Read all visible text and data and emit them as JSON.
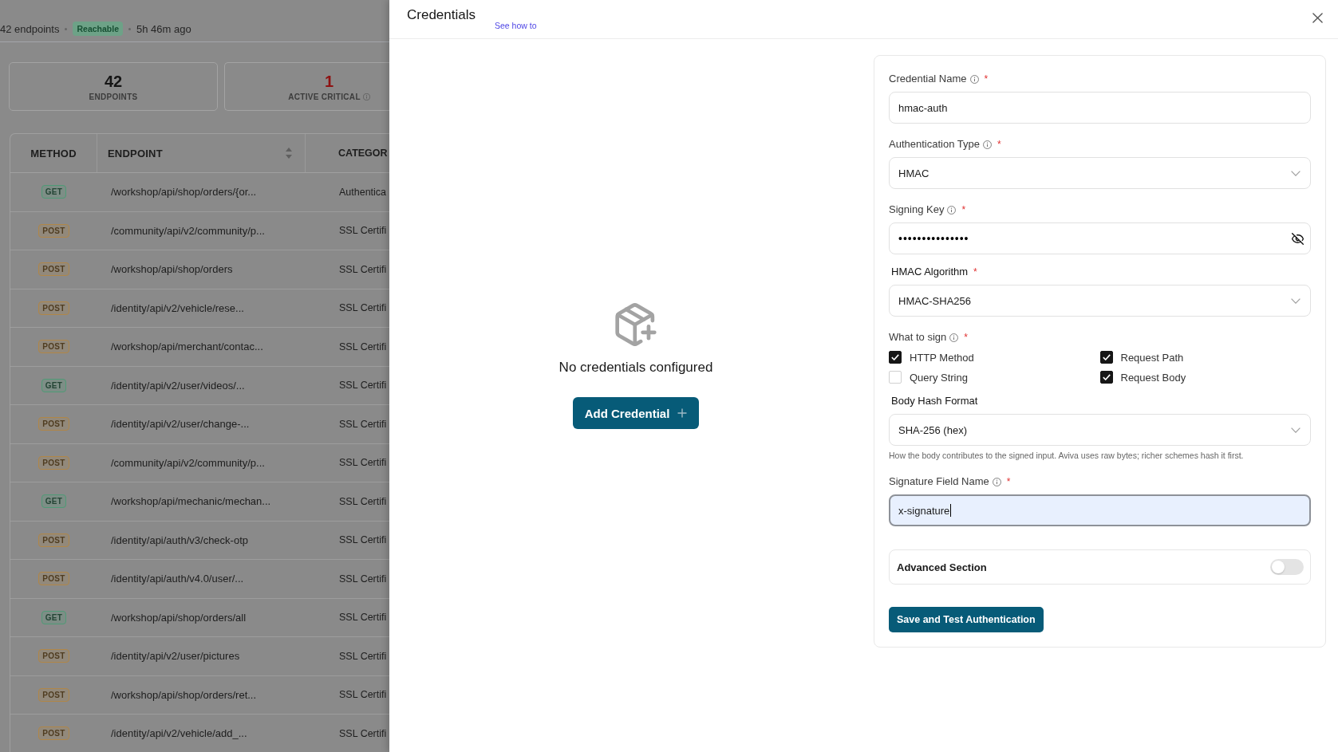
{
  "background_page": {
    "summary": {
      "endpoint_count": "42 endpoints",
      "status": "Reachable",
      "last_checked": "5h 46m ago"
    },
    "stats": [
      {
        "value": "42",
        "label": "ENDPOINTS",
        "kind": "count",
        "info": false
      },
      {
        "value": "1",
        "label": "ACTIVE CRITICAL",
        "kind": "critical",
        "info": true
      }
    ],
    "table": {
      "columns": [
        {
          "label": "METHOD",
          "sortable": false
        },
        {
          "label": "ENDPOINT",
          "sortable": true
        },
        {
          "label": "CATEGOR",
          "sortable": false
        }
      ],
      "rows": [
        {
          "method": {
            "label": "GET",
            "color": "#4f9a76"
          },
          "endpoint": "/workshop/api/shop/orders/{or...",
          "category": "Authentica"
        },
        {
          "method": {
            "label": "POST",
            "color": "#b08648"
          },
          "endpoint": "/community/api/v2/community/p...",
          "category": "SSL Certifi"
        },
        {
          "method": {
            "label": "POST",
            "color": "#b08648"
          },
          "endpoint": "/workshop/api/shop/orders",
          "category": "SSL Certifi"
        },
        {
          "method": {
            "label": "POST",
            "color": "#b08648"
          },
          "endpoint": "/identity/api/v2/vehicle/rese...",
          "category": "SSL Certifi"
        },
        {
          "method": {
            "label": "POST",
            "color": "#b08648"
          },
          "endpoint": "/workshop/api/merchant/contac...",
          "category": "SSL Certifi"
        },
        {
          "method": {
            "label": "GET",
            "color": "#4f9a76"
          },
          "endpoint": "/identity/api/v2/user/videos/...",
          "category": "SSL Certifi"
        },
        {
          "method": {
            "label": "POST",
            "color": "#b08648"
          },
          "endpoint": "/identity/api/v2/user/change-...",
          "category": "SSL Certifi"
        },
        {
          "method": {
            "label": "POST",
            "color": "#b08648"
          },
          "endpoint": "/community/api/v2/community/p...",
          "category": "SSL Certifi"
        },
        {
          "method": {
            "label": "GET",
            "color": "#4f9a76"
          },
          "endpoint": "/workshop/api/mechanic/mechan...",
          "category": "SSL Certifi"
        },
        {
          "method": {
            "label": "POST",
            "color": "#b08648"
          },
          "endpoint": "/identity/api/auth/v3/check-otp",
          "category": "SSL Certifi"
        },
        {
          "method": {
            "label": "POST",
            "color": "#b08648"
          },
          "endpoint": "/identity/api/auth/v4.0/user/...",
          "category": "SSL Certifi"
        },
        {
          "method": {
            "label": "GET",
            "color": "#4f9a76"
          },
          "endpoint": "/workshop/api/shop/orders/all",
          "category": "SSL Certifi"
        },
        {
          "method": {
            "label": "POST",
            "color": "#b08648"
          },
          "endpoint": "/identity/api/v2/user/pictures",
          "category": "SSL Certifi"
        },
        {
          "method": {
            "label": "POST",
            "color": "#b08648"
          },
          "endpoint": "/workshop/api/shop/orders/ret...",
          "category": "SSL Certifi"
        },
        {
          "method": {
            "label": "POST",
            "color": "#b08648"
          },
          "endpoint": "/identity/api/v2/vehicle/add_...",
          "category": "SSL Certifi"
        }
      ]
    }
  },
  "drawer": {
    "title": "Credentials",
    "help_link": "See how to",
    "empty_state": {
      "message": "No credentials configured",
      "action": "Add Credential"
    },
    "form": {
      "required_marker": "*",
      "fields": [
        {
          "kind": "text",
          "label": "Credential Name",
          "info": true,
          "required": true,
          "strong_label": false,
          "value": "hmac-auth",
          "focused": false
        },
        {
          "kind": "select",
          "label": "Authentication Type",
          "info": true,
          "required": true,
          "strong_label": false,
          "value": "HMAC",
          "focused": false
        },
        {
          "kind": "password",
          "label": "Signing Key",
          "info": true,
          "required": true,
          "strong_label": false,
          "value": "•••••••••••••••",
          "focused": false
        },
        {
          "kind": "select",
          "label": "HMAC Algorithm",
          "info": false,
          "required": true,
          "strong_label": true,
          "value": "HMAC-SHA256",
          "focused": false
        },
        {
          "kind": "checkboxes",
          "label": "What to sign",
          "info": true,
          "required": true,
          "strong_label": false,
          "options": [
            {
              "label": "HTTP Method",
              "checked": true
            },
            {
              "label": "Request Path",
              "checked": true
            },
            {
              "label": "Query String",
              "checked": false
            },
            {
              "label": "Request Body",
              "checked": true
            }
          ]
        },
        {
          "kind": "select",
          "label": "Body Hash Format",
          "info": false,
          "required": false,
          "strong_label": true,
          "value": "SHA-256 (hex)",
          "focused": false,
          "help": "How the body contributes to the signed input. Aviva uses raw bytes; richer schemes hash it first."
        },
        {
          "kind": "text",
          "label": "Signature Field Name",
          "info": true,
          "required": true,
          "strong_label": false,
          "value": "x-signature",
          "focused": true
        }
      ],
      "advanced_section": {
        "label": "Advanced Section",
        "on": false
      },
      "submit": "Save and Test Authentication"
    }
  }
}
